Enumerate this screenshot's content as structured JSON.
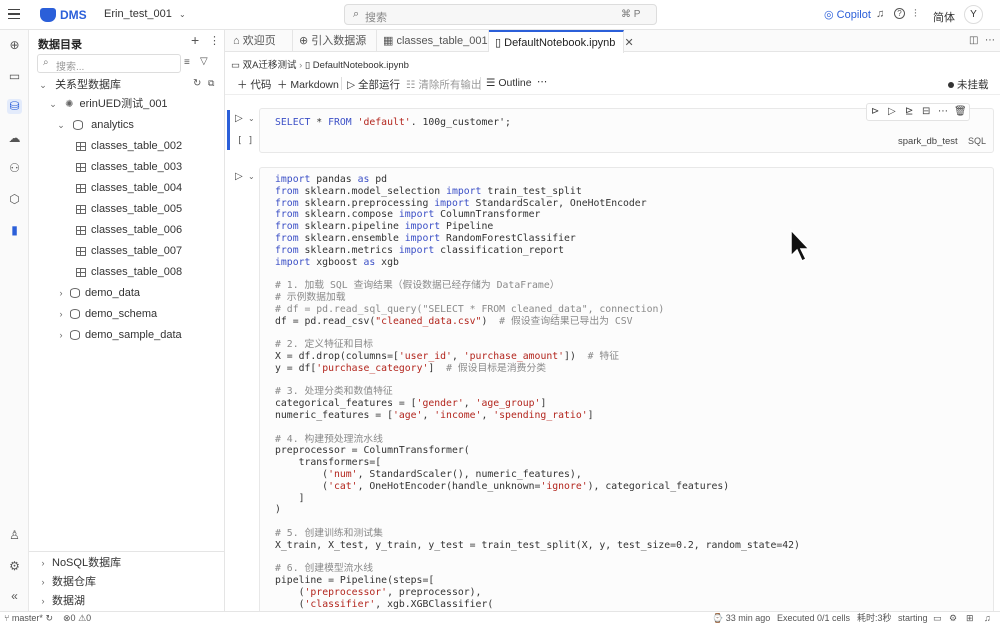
{
  "topbar": {
    "brand": "DMS",
    "workspace": "Erin_test_001",
    "search_placeholder": "搜索",
    "shortcut": "⌘ P",
    "copilot": "Copilot",
    "lang": "简体",
    "avatar": "Y"
  },
  "sidebar": {
    "title": "数据目录",
    "search_placeholder": "搜索...",
    "root": "关系型数据库",
    "instance": "erinUED测试_001",
    "schema": "analytics",
    "tables": [
      "classes_table_002",
      "classes_table_003",
      "classes_table_004",
      "classes_table_005",
      "classes_table_006",
      "classes_table_007",
      "classes_table_008"
    ],
    "others": [
      "demo_data",
      "demo_schema",
      "demo_sample_data"
    ],
    "bottom": [
      "NoSQL数据库",
      "数据仓库",
      "数据湖"
    ]
  },
  "tabs": [
    {
      "label": "欢迎页"
    },
    {
      "label": "引入数据源"
    },
    {
      "label": "classes_table_001"
    },
    {
      "label": "DefaultNotebook.ipynb"
    }
  ],
  "breadcrumb": {
    "folder": "双A迁移测试",
    "file": "DefaultNotebook.ipynb"
  },
  "toolbar": {
    "code": "代码",
    "markdown": "Markdown",
    "run_all": "全部运行",
    "clear": "清除所有输出",
    "outline": "Outline",
    "status": "未挂载"
  },
  "cell1": {
    "exec": "[ ]",
    "db": "spark_db_test",
    "lang": "SQL"
  },
  "status": {
    "branch": "master*",
    "errors": "0",
    "warnings": "0",
    "time_ago": "33 min ago",
    "executed": "Executed 0/1 cells",
    "elapsed": "耗时:3秒",
    "state": "starting"
  }
}
